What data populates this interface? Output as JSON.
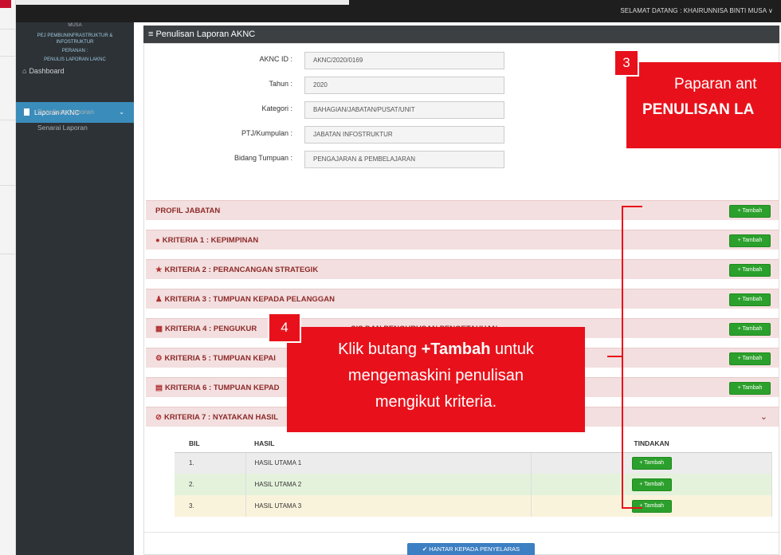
{
  "topbar": {
    "welcome": "SELAMAT DATANG : KHAIRUNNISA BINTI MUSA ∨"
  },
  "sidebar": {
    "user_lines": [
      "MUSA",
      "PEJ PEMBUNINFRASTRUKTUR &",
      "INFOSTRUKTUR",
      "PERANAN :",
      "PENULIS LAPORAN LAKNC"
    ],
    "dashboard": "Dashboard",
    "laporan_akn": "Laporan AKNC",
    "sub_penulisan": "Penulisan Laporan",
    "sub_senarai": "Senarai Laporan"
  },
  "main": {
    "header": "≡ Penulisan Laporan AKNC",
    "form": [
      {
        "label": "AKNC ID :",
        "value": "AKNC/2020/0169"
      },
      {
        "label": "Tahun :",
        "value": "2020"
      },
      {
        "label": "Kategori :",
        "value": "BAHAGIAN/JABATAN/PUSAT/UNIT"
      },
      {
        "label": "PTJ/Kumpulan :",
        "value": "JABATAN INFOSTRUKTUR"
      },
      {
        "label": "Bidang Tumpuan :",
        "value": "PENGAJARAN & PEMBELAJARAN"
      }
    ],
    "kriteria": [
      {
        "icon": "",
        "title": "PROFIL JABATAN"
      },
      {
        "icon": "●",
        "title": "KRITERIA 1 : KEPIMPINAN"
      },
      {
        "icon": "★",
        "title": "KRITERIA 2 : PERANCANGAN STRATEGIK"
      },
      {
        "icon": "♟",
        "title": "KRITERIA 3 : TUMPUAN KEPADA PELANGGAN"
      },
      {
        "icon": "▦",
        "title": "KRITERIA 4 : PENGUKUR"
      },
      {
        "icon": "⚙",
        "title": "KRITERIA 5 : TUMPUAN KEPAI"
      },
      {
        "icon": "▤",
        "title": "KRITERIA 6 : TUMPUAN KEPAD"
      },
      {
        "icon": "⊘",
        "title": "KRITERIA 7 : NYATAKAN HASIL"
      }
    ],
    "kriteria4_tail": "SIS DAN PENGURUSAN PENGETAHUAN",
    "tambah": "+ Tambah",
    "table": {
      "headers": [
        "BIL",
        "HASIL",
        "TINDAKAN"
      ],
      "rows": [
        {
          "bil": "1.",
          "hasil": "HASIL UTAMA 1"
        },
        {
          "bil": "2.",
          "hasil": "HASIL UTAMA 2"
        },
        {
          "bil": "3.",
          "hasil": "HASIL UTAMA 3"
        }
      ]
    },
    "hantar": "✔ HANTAR KEPADA PENYELARAS"
  },
  "annotations": {
    "badge3": "3",
    "callout3_line1": "Paparan ant",
    "callout3_line2": "PENULISAN LA",
    "badge4": "4",
    "callout4_pre": "Klik butang ",
    "callout4_bold": "+Tambah",
    "callout4_post": " untuk",
    "callout4_line2": "mengemaskini penulisan",
    "callout4_line3": "mengikut kriteria."
  },
  "colors": {
    "accent_red": "#e8111b",
    "sidebar": "#2d3236",
    "active": "#3a8dbb",
    "tambah_green": "#2ca02c"
  }
}
